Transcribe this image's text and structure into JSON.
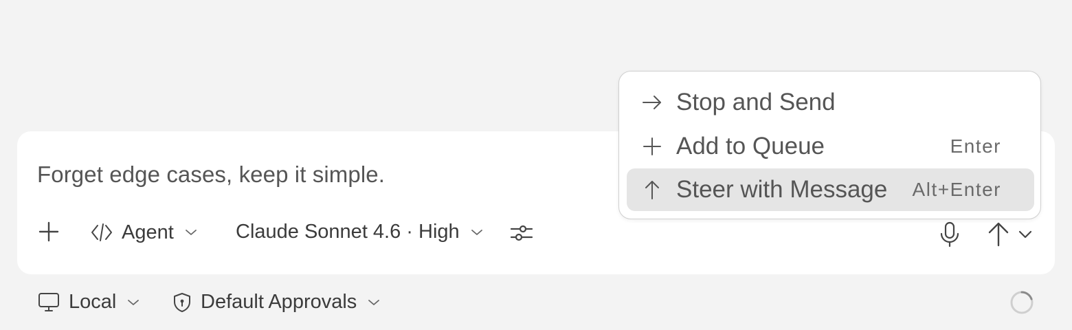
{
  "composer": {
    "prompt_text": "Forget edge cases, keep it simple.",
    "toolbar": {
      "mode_label": "Agent",
      "model_label": "Claude Sonnet 4.6 · High"
    }
  },
  "send_menu": {
    "items": [
      {
        "label": "Stop and Send",
        "shortcut": "",
        "icon": "arrow-right-icon"
      },
      {
        "label": "Add to Queue",
        "shortcut": "Enter",
        "icon": "plus-icon"
      },
      {
        "label": "Steer with Message",
        "shortcut": "Alt+Enter",
        "icon": "arrow-up-icon",
        "highlighted": true
      }
    ]
  },
  "footer": {
    "environment_label": "Local",
    "approvals_label": "Default Approvals"
  }
}
